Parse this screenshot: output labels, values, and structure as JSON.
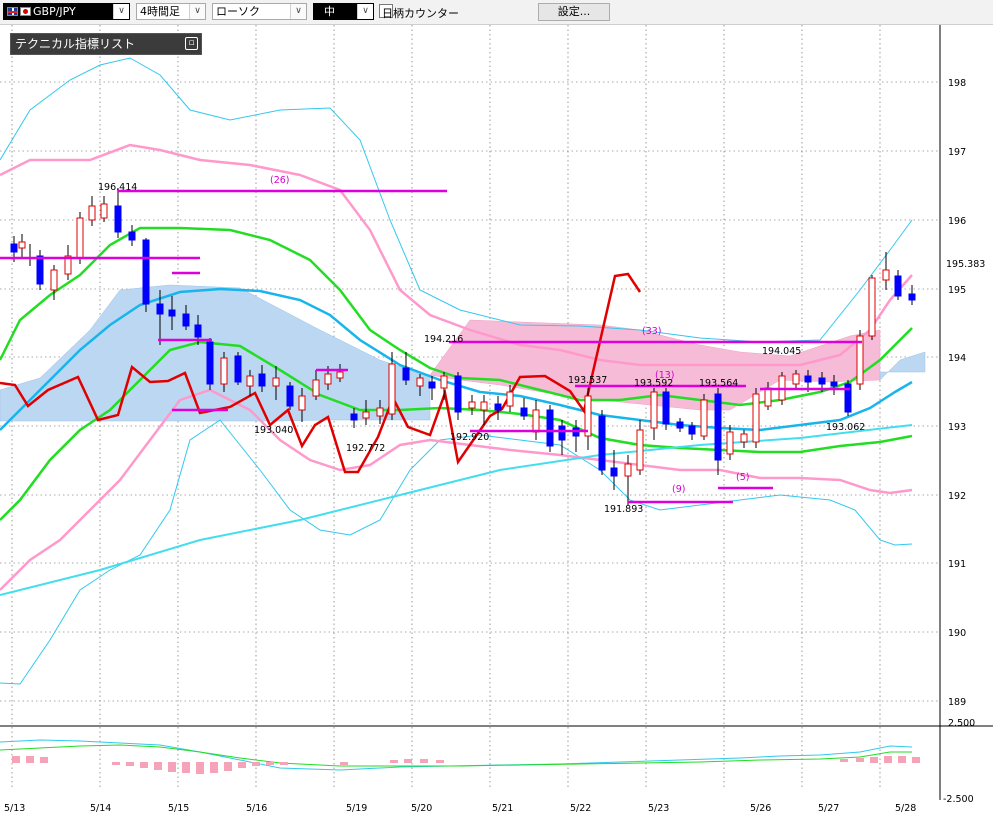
{
  "toolbar": {
    "symbol": "GBP/JPY",
    "timeframe": "4時間足",
    "chart_type": "ローソク",
    "size": "中",
    "counter_label": "日柄カウンター",
    "settings_label": "設定..."
  },
  "tech_panel_label": "テクニカル指標リスト",
  "chart_data": {
    "type": "candlestick",
    "instrument": "GBP/JPY",
    "timeframe": "4時間足",
    "price_ticks": [
      "198",
      "197",
      "196",
      "195",
      "194",
      "193",
      "192",
      "191",
      "190",
      "189"
    ],
    "current_price": "195.383",
    "osc_ticks": [
      "2.500",
      "-2.500"
    ],
    "date_labels": [
      "5/13",
      "5/14",
      "5/15",
      "5/16",
      "5/19",
      "5/20",
      "5/21",
      "5/22",
      "5/23",
      "5/26",
      "5/27",
      "5/28"
    ],
    "price_annotations": [
      "196.414",
      "193.040",
      "192.772",
      "194.216",
      "192.920",
      "193.537",
      "191.893",
      "193.592",
      "193.564",
      "194.045",
      "193.062"
    ],
    "count_labels": [
      "(26)",
      "(33)",
      "(13)",
      "(9)",
      "(5)"
    ],
    "colors": {
      "up": "#e00000",
      "down": "#0000ff",
      "cloud_pos": "#bcd7f2",
      "cloud_neg": "#f6bcd7",
      "magenta": "#dd00dd",
      "lagging": "#e00000"
    }
  }
}
